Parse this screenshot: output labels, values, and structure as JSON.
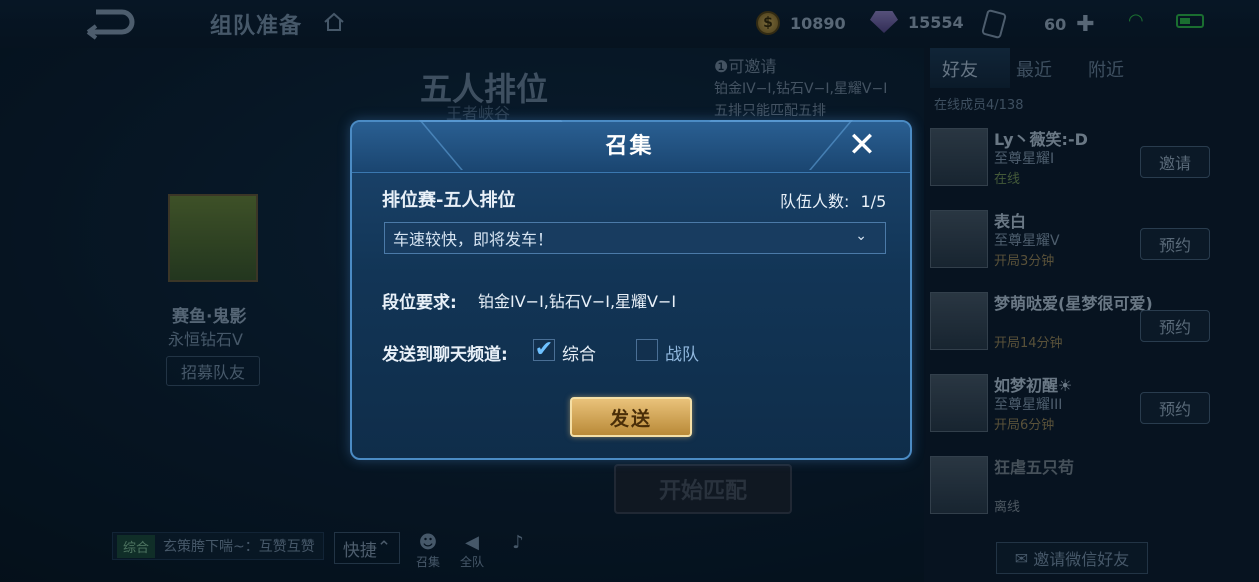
{
  "header": {
    "title": "组队准备",
    "resources": {
      "gold": "10890",
      "diamonds": "15554",
      "tickets": "60"
    }
  },
  "lobby": {
    "mode_title": "五人排位",
    "mode_subtitle": "王者峡谷",
    "invite_note_title": "可邀请",
    "invite_note_ranks": "铂金IV−I,钻石V−I,星耀V−I",
    "invite_note_extra": "五排只能匹配五排",
    "player_name": "赛鱼·鬼影",
    "player_rank": "永恒钻石V",
    "recruit_label": "招募队友",
    "start_match_label": "开始匹配",
    "chat_tag": "综合",
    "chat_message": "玄策胯下喘~：互赞互赞",
    "quick_label": "快捷",
    "summon_label": "召集",
    "voice_label": "全队"
  },
  "friends": {
    "tabs": [
      "好友",
      "最近",
      "附近"
    ],
    "online_label": "在线成员4/138",
    "list": [
      {
        "name": "Ly丶薇笑:-D",
        "rank": "至尊星耀I",
        "status": "在线",
        "action": "邀请"
      },
      {
        "name": "表白",
        "rank": "至尊星耀V",
        "status": "开局3分钟",
        "action": "预约"
      },
      {
        "name": "梦萌哒爱(星梦很可爱)",
        "rank": "",
        "status": "开局14分钟",
        "action": "预约"
      },
      {
        "name": "如梦初醒☀",
        "rank": "至尊星耀III",
        "status": "开局6分钟",
        "action": "预约"
      },
      {
        "name": "狂虐五只苟",
        "rank": "",
        "status": "离线",
        "action": ""
      }
    ],
    "wechat_label": "邀请微信好友"
  },
  "modal": {
    "title": "召集",
    "mode": "排位赛-五人排位",
    "team_count_label": "队伍人数:",
    "team_count": "1/5",
    "message_selected": "车速较快，即将发车！",
    "rank_req_label": "段位要求:",
    "rank_req_value": "铂金IV−I,钻石V−I,星耀V−I",
    "send_channel_label": "发送到聊天频道:",
    "channel_general": "综合",
    "channel_general_checked": true,
    "channel_team": "战队",
    "channel_team_checked": false,
    "send_label": "发送"
  }
}
